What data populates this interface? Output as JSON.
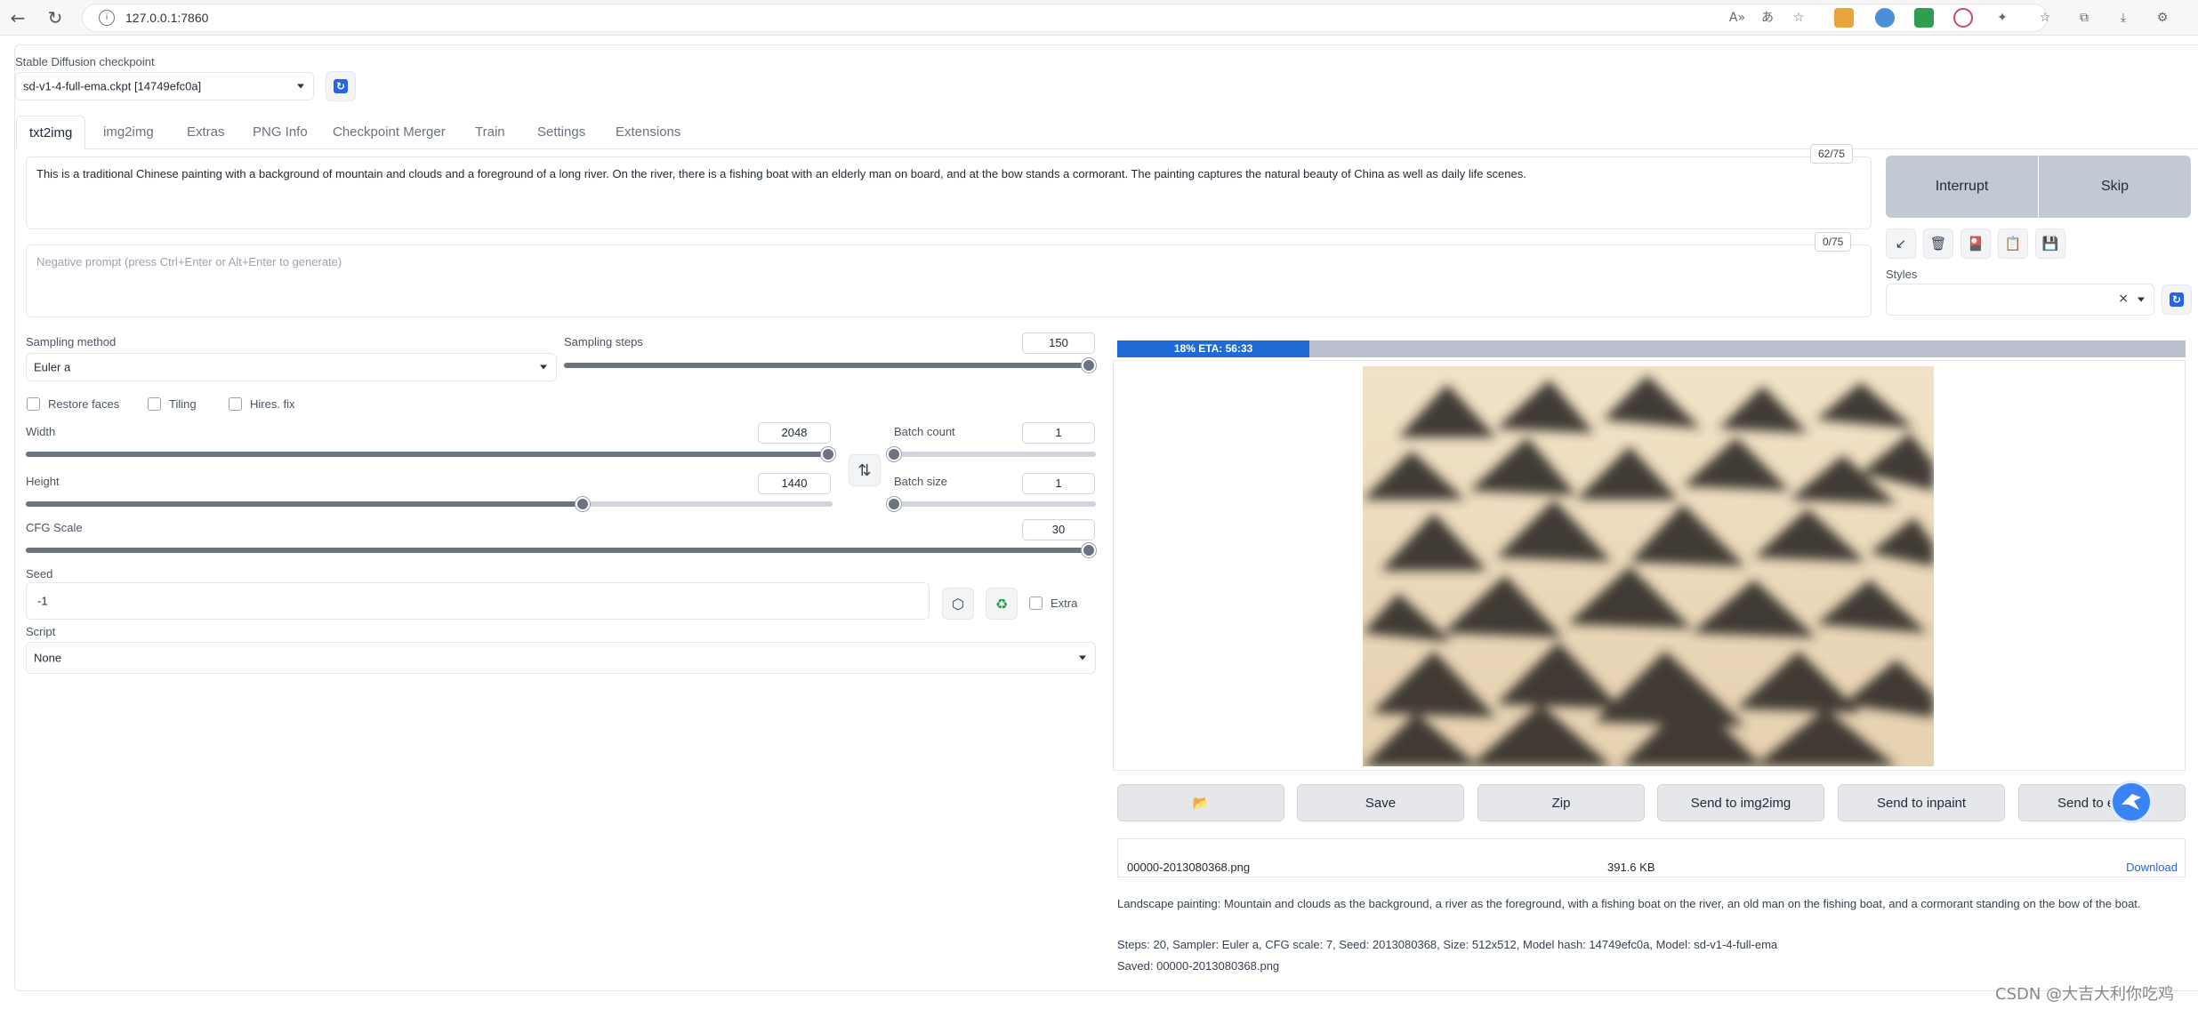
{
  "browser": {
    "url": "127.0.0.1:7860"
  },
  "checkpoint": {
    "label": "Stable Diffusion checkpoint",
    "value": "sd-v1-4-full-ema.ckpt [14749efc0a]"
  },
  "tabs": [
    {
      "label": "txt2img",
      "active": true
    },
    {
      "label": "img2img"
    },
    {
      "label": "Extras"
    },
    {
      "label": "PNG Info"
    },
    {
      "label": "Checkpoint Merger"
    },
    {
      "label": "Train"
    },
    {
      "label": "Settings"
    },
    {
      "label": "Extensions"
    }
  ],
  "prompt": {
    "value": "This is a traditional Chinese painting with a background of mountain and clouds and a foreground of a long river. On the river, there is a fishing boat with an elderly man on board, and at the bow stands a cormorant. The painting captures the natural beauty of China as well as daily life scenes.",
    "counter": "62/75"
  },
  "negative_prompt": {
    "placeholder": "Negative prompt (press Ctrl+Enter or Alt+Enter to generate)",
    "counter": "0/75"
  },
  "buttons": {
    "interrupt": "Interrupt",
    "skip": "Skip"
  },
  "styles": {
    "label": "Styles",
    "clear": "×"
  },
  "sampling": {
    "method_label": "Sampling method",
    "method_value": "Euler a",
    "steps_label": "Sampling steps",
    "steps_value": "150",
    "steps_fraction": 1.0
  },
  "checkboxes": {
    "restore_faces": "Restore faces",
    "tiling": "Tiling",
    "hires_fix": "Hires. fix",
    "extra": "Extra"
  },
  "width": {
    "label": "Width",
    "value": "2048",
    "fraction": 1.0
  },
  "height": {
    "label": "Height",
    "value": "1440",
    "fraction": 0.69
  },
  "batch_count": {
    "label": "Batch count",
    "value": "1",
    "fraction": 0.0
  },
  "batch_size": {
    "label": "Batch size",
    "value": "1",
    "fraction": 0.0
  },
  "cfg": {
    "label": "CFG Scale",
    "value": "30",
    "fraction": 1.0
  },
  "seed": {
    "label": "Seed",
    "value": "-1"
  },
  "script": {
    "label": "Script",
    "value": "None"
  },
  "progress": {
    "text": "18% ETA: 56:33",
    "fraction": 0.18
  },
  "actions": {
    "folder": "📂",
    "save": "Save",
    "zip": "Zip",
    "send_img2img": "Send to img2img",
    "send_inpaint": "Send to inpaint",
    "send_extras": "Send to e"
  },
  "file": {
    "name": "00000-2013080368.png",
    "size": "391.6 KB",
    "download": "Download"
  },
  "info": {
    "description": "Landscape painting: Mountain and clouds as the background, a river as the foreground, with a fishing boat on the river, an old man on the fishing boat, and a cormorant standing on the bow of the boat.",
    "params": "Steps: 20, Sampler: Euler a, CFG scale: 7, Seed: 2013080368, Size: 512x512, Model hash: 14749efc0a, Model: sd-v1-4-full-ema",
    "saved": "Saved: 00000-2013080368.png"
  },
  "watermark": "CSDN @大吉大利你吃鸡",
  "colors": {
    "accent": "#1e6bd6",
    "progress_bg": "#b7c0cc",
    "big_button": "#c2c9d4"
  }
}
